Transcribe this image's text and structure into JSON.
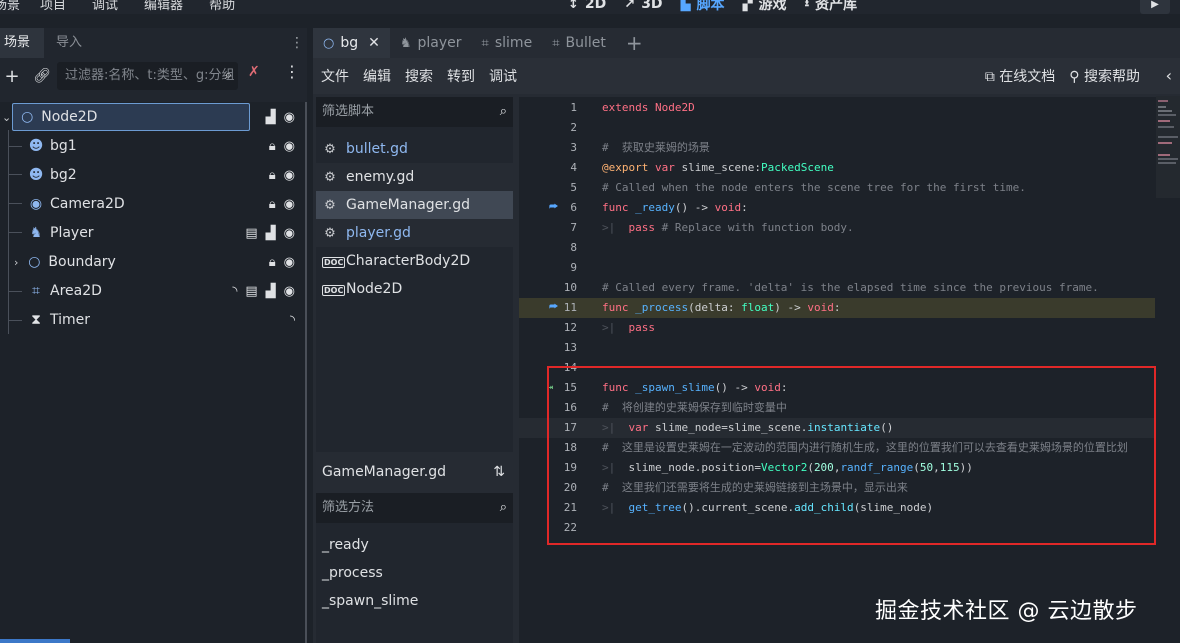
{
  "top_menu": [
    "场景",
    "项目",
    "调试",
    "编辑器",
    "帮助"
  ],
  "workspaces": [
    {
      "label": "2D",
      "glyph": "↕"
    },
    {
      "label": "3D",
      "glyph": "↗"
    },
    {
      "label": "脚本",
      "glyph": "▙"
    },
    {
      "label": "游戏",
      "glyph": "▞"
    },
    {
      "label": "资产库",
      "glyph": "⭳"
    }
  ],
  "play_glyph": "▶",
  "dock": {
    "tabs": [
      "场景",
      "导入"
    ],
    "filter_placeholder": "过滤器:名称、t:类型、g:分组",
    "nodes": [
      {
        "name": "Node2D",
        "icon": "○"
      },
      {
        "name": "bg1",
        "icon": "☻"
      },
      {
        "name": "bg2",
        "icon": "☻"
      },
      {
        "name": "Camera2D",
        "icon": "◉"
      },
      {
        "name": "Player",
        "icon": "♞"
      },
      {
        "name": "Boundary",
        "icon": "○"
      },
      {
        "name": "Area2D",
        "icon": "⌗"
      },
      {
        "name": "Timer",
        "icon": "⧗"
      }
    ]
  },
  "script_tabs": [
    {
      "label": "bg",
      "glyph": "○"
    },
    {
      "label": "player",
      "glyph": "♞"
    },
    {
      "label": "slime",
      "glyph": "⌗"
    },
    {
      "label": "Bullet",
      "glyph": "⌗"
    }
  ],
  "editor_menu": [
    "文件",
    "编辑",
    "搜索",
    "转到",
    "调试"
  ],
  "editor_right": [
    "在线文档",
    "搜索帮助"
  ],
  "script_filter_placeholder": "筛选脚本",
  "scripts": [
    {
      "name": "bullet.gd",
      "type": "script"
    },
    {
      "name": "enemy.gd",
      "type": "script"
    },
    {
      "name": "GameManager.gd",
      "type": "script"
    },
    {
      "name": "player.gd",
      "type": "script"
    },
    {
      "name": "CharacterBody2D",
      "type": "doc"
    },
    {
      "name": "Node2D",
      "type": "doc"
    }
  ],
  "current_script": "GameManager.gd",
  "method_filter_placeholder": "筛选方法",
  "methods": [
    "_ready",
    "_process",
    "_spawn_slime"
  ],
  "code_lines": [
    "1",
    "2",
    "3",
    "4",
    "5",
    "6",
    "7",
    "8",
    "9",
    "10",
    "11",
    "12",
    "13",
    "14",
    "15",
    "16",
    "17",
    "18",
    "19",
    "20",
    "21",
    "22"
  ],
  "code": {
    "l1": "extends Node2D",
    "l3": "#  获取史莱姆的场景",
    "l4_a": "@export",
    "l4_b": " var ",
    "l4_c": "slime_scene:",
    "l4_d": "PackedScene",
    "l5": "# Called when the node enters the scene tree for the first time.",
    "l6_a": "func ",
    "l6_b": "_ready",
    "l6_c": "() -> ",
    "l6_d": "void",
    "l7_a": "pass",
    "l7_b": " # Replace with function body.",
    "l10": "# Called every frame. 'delta' is the elapsed time since the previous frame.",
    "l11_a": "func ",
    "l11_b": "_process",
    "l11_c": "(delta: ",
    "l11_d": "float",
    "l11_e": ") -> ",
    "l11_f": "void",
    "l12": "pass",
    "l15_a": "func ",
    "l15_b": "_spawn_slime",
    "l15_c": "() -> ",
    "l15_d": "void",
    "l16": "#  将创建的史莱姆保存到临时变量中",
    "l17_a": "var",
    "l17_b": " slime_node=slime_scene.",
    "l17_c": "instantiate",
    "l17_d": "()",
    "l18": "#  这里是设置史莱姆在一定波动的范围内进行随机生成，这里的位置我们可以去查看史莱姆场景的位置比划",
    "l19_a": "slime_node.position=",
    "l19_b": "Vector2",
    "l19_c": "(",
    "l19_d": "200",
    "l19_e": ",",
    "l19_f": "randf_range",
    "l19_g": "(",
    "l19_h": "50",
    "l19_i": ",",
    "l19_j": "115",
    "l19_k": "))",
    "l20": "#  这里我们还需要将生成的史莱姆链接到主场景中，显示出来",
    "l21_a": "get_tree",
    "l21_b": "().current_scene.",
    "l21_c": "add_child",
    "l21_d": "(slime_node)"
  },
  "watermark": "掘金技术社区 @ 云边散步"
}
